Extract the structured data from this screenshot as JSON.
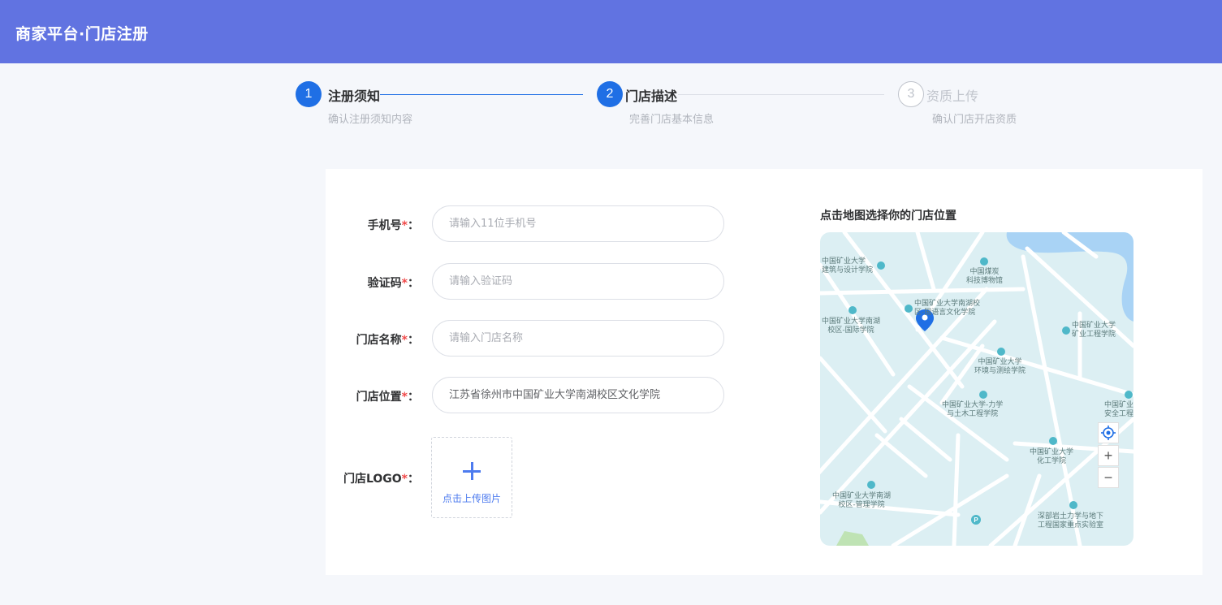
{
  "app": {
    "title": "商家平台·门店注册"
  },
  "steps": [
    {
      "number": "1",
      "label": "注册须知",
      "desc": "确认注册须知内容",
      "status": "done"
    },
    {
      "number": "2",
      "label": "门店描述",
      "desc": "完善门店基本信息",
      "status": "active"
    },
    {
      "number": "3",
      "label": "资质上传",
      "desc": "确认门店开店资质",
      "status": "wait"
    }
  ],
  "form": {
    "required_mark": "*",
    "colon": "：",
    "phone": {
      "label": "手机号",
      "placeholder": "请输入11位手机号",
      "value": ""
    },
    "code": {
      "label": "验证码",
      "placeholder": "请输入验证码",
      "value": ""
    },
    "store_name": {
      "label": "门店名称",
      "placeholder": "请输入门店名称",
      "value": ""
    },
    "store_location": {
      "label": "门店位置",
      "placeholder": "",
      "value": "江苏省徐州市中国矿业大学南湖校区文化学院"
    },
    "logo": {
      "label": "门店LOGO",
      "upload_text": "点击上传图片"
    }
  },
  "map": {
    "title": "点击地图选择你的门店位置",
    "pois": [
      "中国矿业大学\n建筑与设计学院",
      "中国煤炭\n科技博物馆",
      "中国矿业大学南湖校\n区-国语言文化学院",
      "中国矿业大学南湖\n校区-国际学院",
      "中国矿业大学\n矿业工程学院",
      "中国矿业大学\n环境与测绘学院",
      "中国矿业大学-力学\n与土木工程学院",
      "中国矿业大\n安全工程",
      "中国矿业大学\n化工学院",
      "中国矿业大学南湖\n校区-管理学院",
      "深部岩土力学与地下\n工程国家重点实验室"
    ],
    "controls": {
      "locate": "locate-icon",
      "zoom_in": "+",
      "zoom_out": "−"
    }
  },
  "colors": {
    "header": "#6173e1",
    "primary": "#1f6fe5",
    "required": "#f04848",
    "upload": "#4d7bef"
  }
}
